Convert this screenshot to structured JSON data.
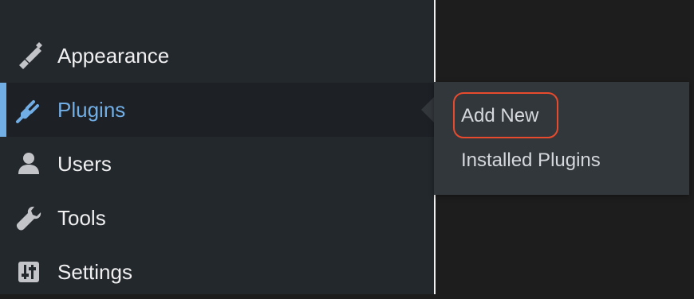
{
  "sidebar": {
    "items": [
      {
        "label": "Appearance",
        "icon": "brush-icon"
      },
      {
        "label": "Plugins",
        "icon": "plug-icon",
        "active": true
      },
      {
        "label": "Users",
        "icon": "user-icon"
      },
      {
        "label": "Tools",
        "icon": "wrench-icon"
      },
      {
        "label": "Settings",
        "icon": "sliders-icon"
      }
    ]
  },
  "flyout": {
    "items": [
      {
        "label": "Add New"
      },
      {
        "label": "Installed Plugins"
      }
    ]
  },
  "colors": {
    "sidebar_bg": "#23282d",
    "active_bg": "#1d2126",
    "active_text": "#72aee6",
    "flyout_bg": "#32373c",
    "highlight": "#e84a2d"
  }
}
